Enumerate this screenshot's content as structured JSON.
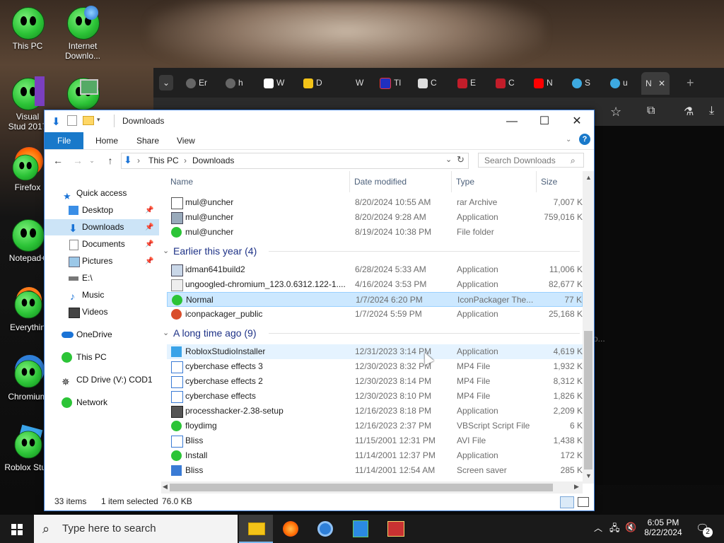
{
  "desktop": {
    "icons": [
      {
        "label": "This PC"
      },
      {
        "label": "Internet Downlo..."
      },
      {
        "label": "Visual Stud 2017"
      },
      {
        "label": "Firefox"
      },
      {
        "label": "Notepad+"
      },
      {
        "label": "Everythin"
      },
      {
        "label": "Chromium"
      },
      {
        "label": "Roblox Stud"
      }
    ]
  },
  "browser": {
    "tabs": [
      {
        "label": "Er"
      },
      {
        "label": "h"
      },
      {
        "label": "W"
      },
      {
        "label": "D"
      },
      {
        "label": "W"
      },
      {
        "label": "Tl"
      },
      {
        "label": "C"
      },
      {
        "label": "E"
      },
      {
        "label": "C"
      },
      {
        "label": "N"
      },
      {
        "label": "S"
      },
      {
        "label": "u"
      },
      {
        "label": "N"
      }
    ],
    "new_tab": "+",
    "close_tab": "✕",
    "ellipsis": "o..."
  },
  "explorer": {
    "title": "Downloads",
    "ribbon": {
      "file": "File",
      "home": "Home",
      "share": "Share",
      "view": "View"
    },
    "breadcrumb": {
      "root": "This PC",
      "folder": "Downloads"
    },
    "search_placeholder": "Search Downloads",
    "columns": {
      "name": "Name",
      "date": "Date modified",
      "type": "Type",
      "size": "Size"
    },
    "nav": {
      "quick_access": "Quick access",
      "desktop": "Desktop",
      "downloads": "Downloads",
      "documents": "Documents",
      "pictures": "Pictures",
      "e_drive": "E:\\",
      "music": "Music",
      "videos": "Videos",
      "onedrive": "OneDrive",
      "this_pc": "This PC",
      "cd_drive": "CD Drive (V:) COD1",
      "network": "Network"
    },
    "top_rows": [
      {
        "name": "mul@uncher",
        "date": "8/20/2024 10:55 AM",
        "type": "rar Archive",
        "size": "7,007 K"
      },
      {
        "name": "mul@uncher",
        "date": "8/20/2024 9:28 AM",
        "type": "Application",
        "size": "759,016 K"
      },
      {
        "name": "mul@uncher",
        "date": "8/19/2024 10:38 PM",
        "type": "File folder",
        "size": ""
      }
    ],
    "group_earlier": "Earlier this year (4)",
    "earlier_rows": [
      {
        "name": "idman641build2",
        "date": "6/28/2024 5:33 AM",
        "type": "Application",
        "size": "11,006 K"
      },
      {
        "name": "ungoogled-chromium_123.0.6312.122-1....",
        "date": "4/16/2024 3:53 PM",
        "type": "Application",
        "size": "82,677 K"
      },
      {
        "name": "Normal",
        "date": "1/7/2024 6:20 PM",
        "type": "IconPackager The...",
        "size": "77 K"
      },
      {
        "name": "iconpackager_public",
        "date": "1/7/2024 5:59 PM",
        "type": "Application",
        "size": "25,168 K"
      }
    ],
    "group_long": "A long time ago (9)",
    "long_rows": [
      {
        "name": "RobloxStudioInstaller",
        "date": "12/31/2023 3:14 PM",
        "type": "Application",
        "size": "4,619 K"
      },
      {
        "name": "cyberchase effects 3",
        "date": "12/30/2023 8:32 PM",
        "type": "MP4 File",
        "size": "1,932 K"
      },
      {
        "name": "cyberchase effects 2",
        "date": "12/30/2023 8:14 PM",
        "type": "MP4 File",
        "size": "8,312 K"
      },
      {
        "name": "cyberchase effects",
        "date": "12/30/2023 8:10 PM",
        "type": "MP4 File",
        "size": "1,826 K"
      },
      {
        "name": "processhacker-2.38-setup",
        "date": "12/16/2023 8:18 PM",
        "type": "Application",
        "size": "2,209 K"
      },
      {
        "name": "floydimg",
        "date": "12/16/2023 2:37 PM",
        "type": "VBScript Script File",
        "size": "6 K"
      },
      {
        "name": "Bliss",
        "date": "11/15/2001 12:31 PM",
        "type": "AVI File",
        "size": "1,438 K"
      },
      {
        "name": "Install",
        "date": "11/14/2001 12:37 PM",
        "type": "Application",
        "size": "172 K"
      },
      {
        "name": "Bliss",
        "date": "11/14/2001 12:54 AM",
        "type": "Screen saver",
        "size": "285 K"
      }
    ],
    "status": {
      "items": "33 items",
      "selected": "1 item selected",
      "size": "76.0 KB"
    }
  },
  "taskbar": {
    "search_placeholder": "Type here to search",
    "time": "6:05 PM",
    "date": "8/22/2024",
    "notification_count": "2"
  }
}
